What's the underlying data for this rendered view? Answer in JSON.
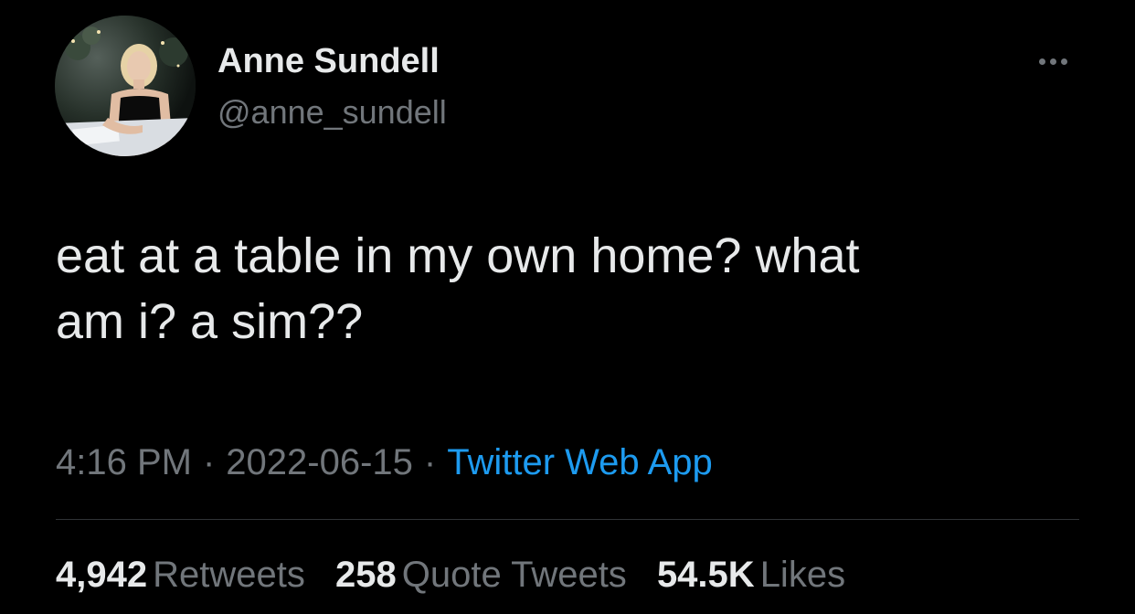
{
  "author": {
    "name": "Anne Sundell",
    "handle": "@anne_sundell"
  },
  "tweet": {
    "text": "eat at a table in my own home? what\nam i? a sim??"
  },
  "meta": {
    "time": "4:16 PM",
    "separator": "·",
    "date": "2022-06-15",
    "source": "Twitter Web App"
  },
  "stats": {
    "retweets": {
      "count": "4,942",
      "label": "Retweets"
    },
    "quotes": {
      "count": "258",
      "label": "Quote Tweets"
    },
    "likes": {
      "count": "54.5K",
      "label": "Likes"
    }
  },
  "icons": {
    "more": "more-options-icon"
  },
  "colors": {
    "background": "#000000",
    "primary_text": "#e7e9ea",
    "secondary_text": "#71767b",
    "link": "#1d9bf0",
    "divider": "#2f3336"
  }
}
